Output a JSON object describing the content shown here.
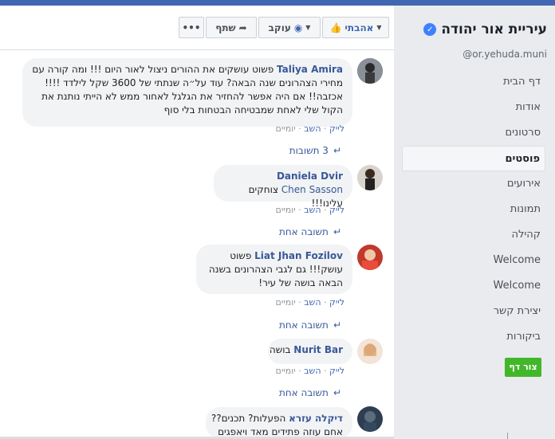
{
  "sidebar": {
    "page_title": "עיריית אור יהודה",
    "verified_badge": "✓",
    "handle": "@or.yehuda.muni",
    "nav": [
      {
        "label": "דף הבית",
        "active": false
      },
      {
        "label": "אודות",
        "active": false
      },
      {
        "label": "סרטונים",
        "active": false
      },
      {
        "label": "פוסטים",
        "active": true
      },
      {
        "label": "אירועים",
        "active": false
      },
      {
        "label": "תמונות",
        "active": false
      },
      {
        "label": "קהילה",
        "active": false
      },
      {
        "label": "Welcome",
        "active": false
      },
      {
        "label": "Welcome",
        "active": false
      },
      {
        "label": "יצירת קשר",
        "active": false
      },
      {
        "label": "ביקורות",
        "active": false
      }
    ],
    "create_page_button": "צור דף"
  },
  "toolbar": {
    "liked_label": "אהבתי",
    "follow_label": "עוקב",
    "share_label": "שתף",
    "more_label": "•••"
  },
  "comment_actions": {
    "like": "לייק",
    "reply": "השב",
    "separator": " · ",
    "time": "יומיים"
  },
  "comments": [
    {
      "author": "Taliya Amira",
      "text": "פשוט עושקים את ההורים ניצול לאור היום !!! ומה קורה עם מחירי הצהרונים שנה הבאה? עוד על״ה שנתתי של 3600 שקל לילדד !!!! אכזבה!! אם היה אפשר להחזיר את הגלגל לאחור ממש לא הייתי נותנת את הקול שלי לאחת שמבטיחה הבטחות בלי סוף",
      "replies": "3 תשובות"
    },
    {
      "author": "Daniela Dvir",
      "mention": "Chen Sasson",
      "text": "צוחקים עלינו!!!",
      "replies": "תשובה אחת"
    },
    {
      "author": "Liat Jhan Fozilov",
      "text": "פשוט עושק!!! גם לגבי הצהרונים בשנה הבאה בושה של עיר!",
      "replies": "תשובה אחת"
    },
    {
      "author": "Nurit Bar",
      "text": "בושה",
      "replies": "תשובה אחת"
    },
    {
      "author": "דיקלה עזרא",
      "text": "הפעלות? תכנים?? ",
      "line2": "אחם עוזה פתידים מאד ויאפגים",
      "replies": ""
    }
  ],
  "colors": {
    "topbar": "#4267b2",
    "sidebar_bg": "#e9ebee",
    "link": "#385898",
    "create_button": "#42b72a",
    "verified": "#4080ff"
  }
}
